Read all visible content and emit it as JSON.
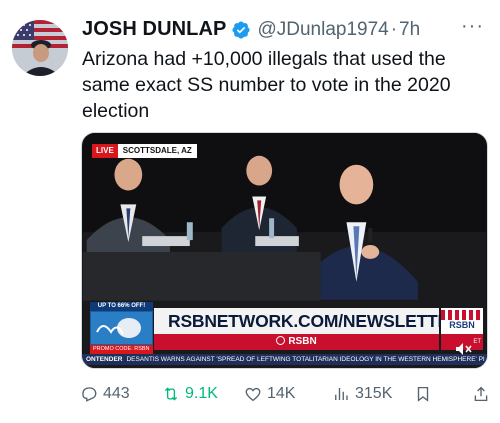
{
  "author": {
    "name": "JOSH DUNLAP",
    "handle": "@JDunlap1974",
    "separator": "·",
    "time": "7h"
  },
  "more_label": "···",
  "tweet": {
    "text": "Arizona had +10,000 illegals that used the same exact SS number to  vote in the 2020 election"
  },
  "media": {
    "live_label": "LIVE",
    "location": "SCOTTSDALE, AZ",
    "promo_top": "UP TO 66% OFF!",
    "promo_code": "PROMO CODE: RSBN",
    "newsletter": "RSBNETWORK.COM/NEWSLETTER",
    "network": "RSBN",
    "logo_text": "RSBN",
    "right_edge": "ET",
    "crawl_tag": "ONTENDER",
    "crawl_text": "DESANTIS WARNS AGAINST 'SPREAD OF LEFTWING TOTALITARIAN IDEOLOGY IN THE WESTERN HEMISPHERE'",
    "crawl_tail": "PI",
    "mute_icon": "mute-icon"
  },
  "actions": {
    "replies": "443",
    "retweets": "9.1K",
    "likes": "14K",
    "views": "315K"
  },
  "colors": {
    "verified": "#1d9bf0",
    "retweet": "#00ba7c",
    "muted_text": "#536471",
    "live_red": "#d8161b"
  }
}
